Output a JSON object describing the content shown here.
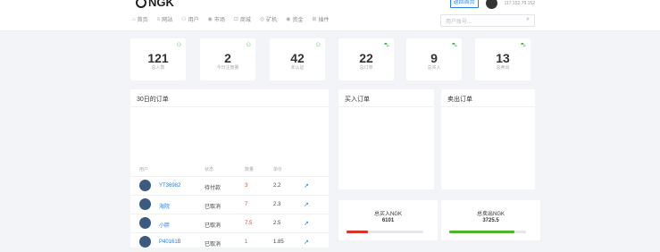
{
  "brand": {
    "name": "NGK"
  },
  "topbar": {
    "button_label": "返回首页",
    "ip": "117.152.79.152"
  },
  "nav": [
    {
      "icon": "⌂",
      "label": "首页"
    },
    {
      "icon": "≡",
      "label": "网站"
    },
    {
      "icon": "⚇",
      "label": "用户"
    },
    {
      "icon": "◉",
      "label": "市场"
    },
    {
      "icon": "⊡",
      "label": "商城"
    },
    {
      "icon": "◎",
      "label": "矿机"
    },
    {
      "icon": "◉",
      "label": "资金"
    },
    {
      "icon": "⊞",
      "label": "插件"
    }
  ],
  "search": {
    "placeholder": "用户账号..."
  },
  "stats": [
    {
      "value": "121",
      "label": "总人数",
      "icon": "user-icon",
      "glyph": "⚇"
    },
    {
      "value": "2",
      "label": "今日注册量",
      "icon": "user-icon",
      "glyph": "⚇"
    },
    {
      "value": "42",
      "label": "未认证",
      "icon": "user-icon",
      "glyph": "⚇"
    },
    {
      "value": "22",
      "label": "总订单",
      "icon": "cart-icon",
      "glyph": "⛍"
    },
    {
      "value": "9",
      "label": "总买入",
      "icon": "cart-icon",
      "glyph": "⛍"
    },
    {
      "value": "13",
      "label": "总卖出",
      "icon": "cart-icon",
      "glyph": "⛍"
    }
  ],
  "orders_card": {
    "title": "30日的订单",
    "columns": [
      "用户",
      "状态",
      "数量",
      "单价"
    ],
    "rows": [
      {
        "user": "YT36982",
        "status": "待付款",
        "qty": "3",
        "price": "2.2"
      },
      {
        "user": "海院",
        "status": "已取消",
        "qty": "7",
        "price": "2.3"
      },
      {
        "user": "小胖",
        "status": "已取消",
        "qty": "7.5",
        "price": "2.5"
      },
      {
        "user": "P40161B",
        "status": "已取消",
        "qty": "1",
        "price": "1.85"
      }
    ]
  },
  "buy_card": {
    "title": "买入订单"
  },
  "sell_card": {
    "title": "卖出订单"
  },
  "totals": {
    "buy": {
      "label": "总买入NGK",
      "value": "6101",
      "progress": 0.28,
      "color": "#d9342b"
    },
    "sell": {
      "label": "总卖出NGK",
      "value": "3725.5",
      "progress": 0.85,
      "color": "#4cb52a"
    }
  }
}
